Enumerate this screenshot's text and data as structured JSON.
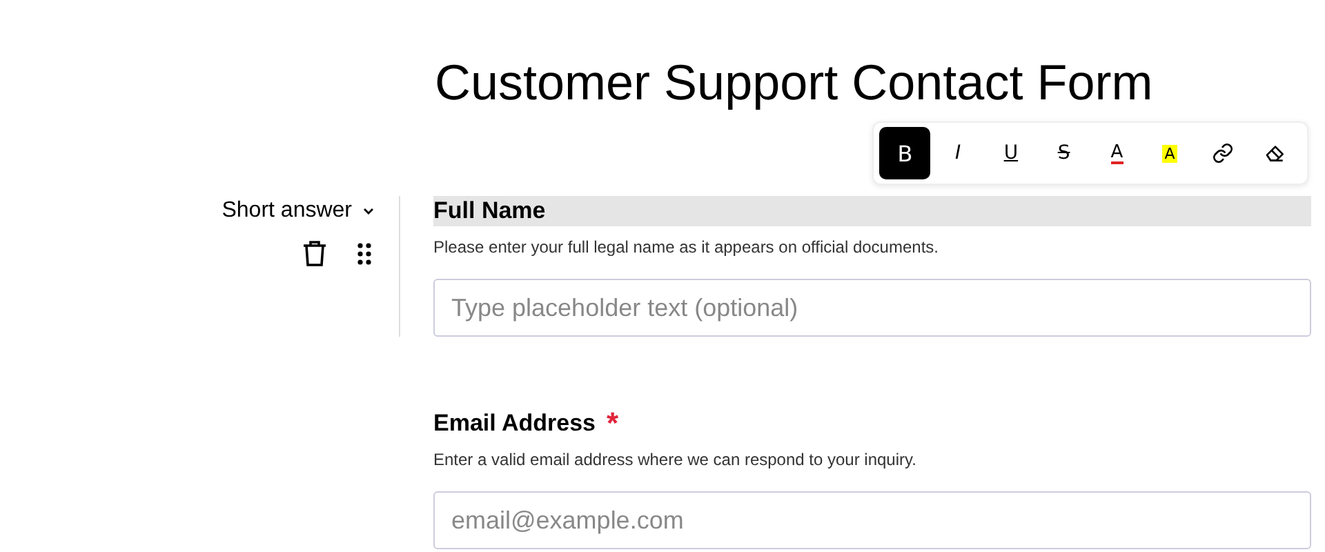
{
  "form": {
    "title": "Customer Support Contact Form"
  },
  "toolbar": [
    {
      "kind": "bold",
      "label": "B",
      "selected": true
    },
    {
      "kind": "italic",
      "label": "I",
      "selected": false
    },
    {
      "kind": "underline",
      "label": "U",
      "selected": false
    },
    {
      "kind": "strike",
      "label": "S",
      "selected": false
    },
    {
      "kind": "color",
      "label": "A",
      "selected": false,
      "color": "#e02424"
    },
    {
      "kind": "highlight",
      "label": "A",
      "selected": false,
      "color": "#ffff00"
    },
    {
      "kind": "link",
      "selected": false
    },
    {
      "kind": "eraser",
      "selected": false
    }
  ],
  "questions": [
    {
      "type_label": "Short answer",
      "label": "Full Name",
      "active": true,
      "description": "Please enter your full legal name as it appears on official documents.",
      "placeholder": "Type placeholder text (optional)"
    },
    {
      "label": "Email Address",
      "active": false,
      "required": true,
      "required_mark": "*",
      "description": "Enter a valid email address where we can respond to your inquiry.",
      "placeholder": "email@example.com"
    }
  ]
}
